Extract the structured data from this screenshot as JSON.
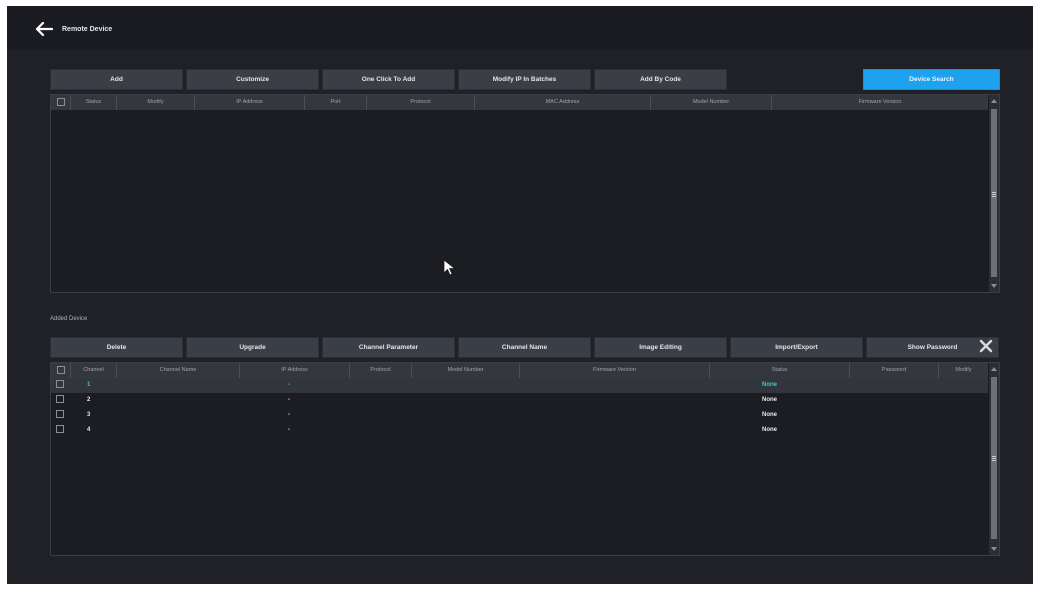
{
  "window": {
    "title": "Remote Device",
    "back_icon": "arrow-left-icon"
  },
  "search_toolbar": {
    "buttons": [
      "Add",
      "Customize",
      "One Click To Add",
      "Modify IP In Batches",
      "Add By Code"
    ],
    "device_search": "Device Search"
  },
  "search_table": {
    "columns": [
      "Status",
      "Modify",
      "IP Address",
      "Port",
      "Protocol",
      "MAC Address",
      "Model Number",
      "Firmware Version"
    ],
    "rows": []
  },
  "added_section": {
    "label": "Added Device",
    "buttons": [
      "Delete",
      "Upgrade",
      "Channel Parameter",
      "Channel Name",
      "Image Editing",
      "Import/Export",
      "Show Password"
    ],
    "close_icon": "close-icon"
  },
  "added_table": {
    "columns": [
      "Channel",
      "Channel Name",
      "IP Address",
      "Protocol",
      "Model Number",
      "Firmware Version",
      "Status",
      "Password",
      "Modify"
    ],
    "rows": [
      {
        "channel": "1",
        "ip": "-",
        "status": "None"
      },
      {
        "channel": "2",
        "ip": "-",
        "status": "None"
      },
      {
        "channel": "3",
        "ip": "-",
        "status": "None"
      },
      {
        "channel": "4",
        "ip": "-",
        "status": "None"
      }
    ]
  },
  "colors": {
    "background": "#1f2127",
    "accent": "#1ea2ee",
    "highlight_text": "#3fc6cf"
  }
}
